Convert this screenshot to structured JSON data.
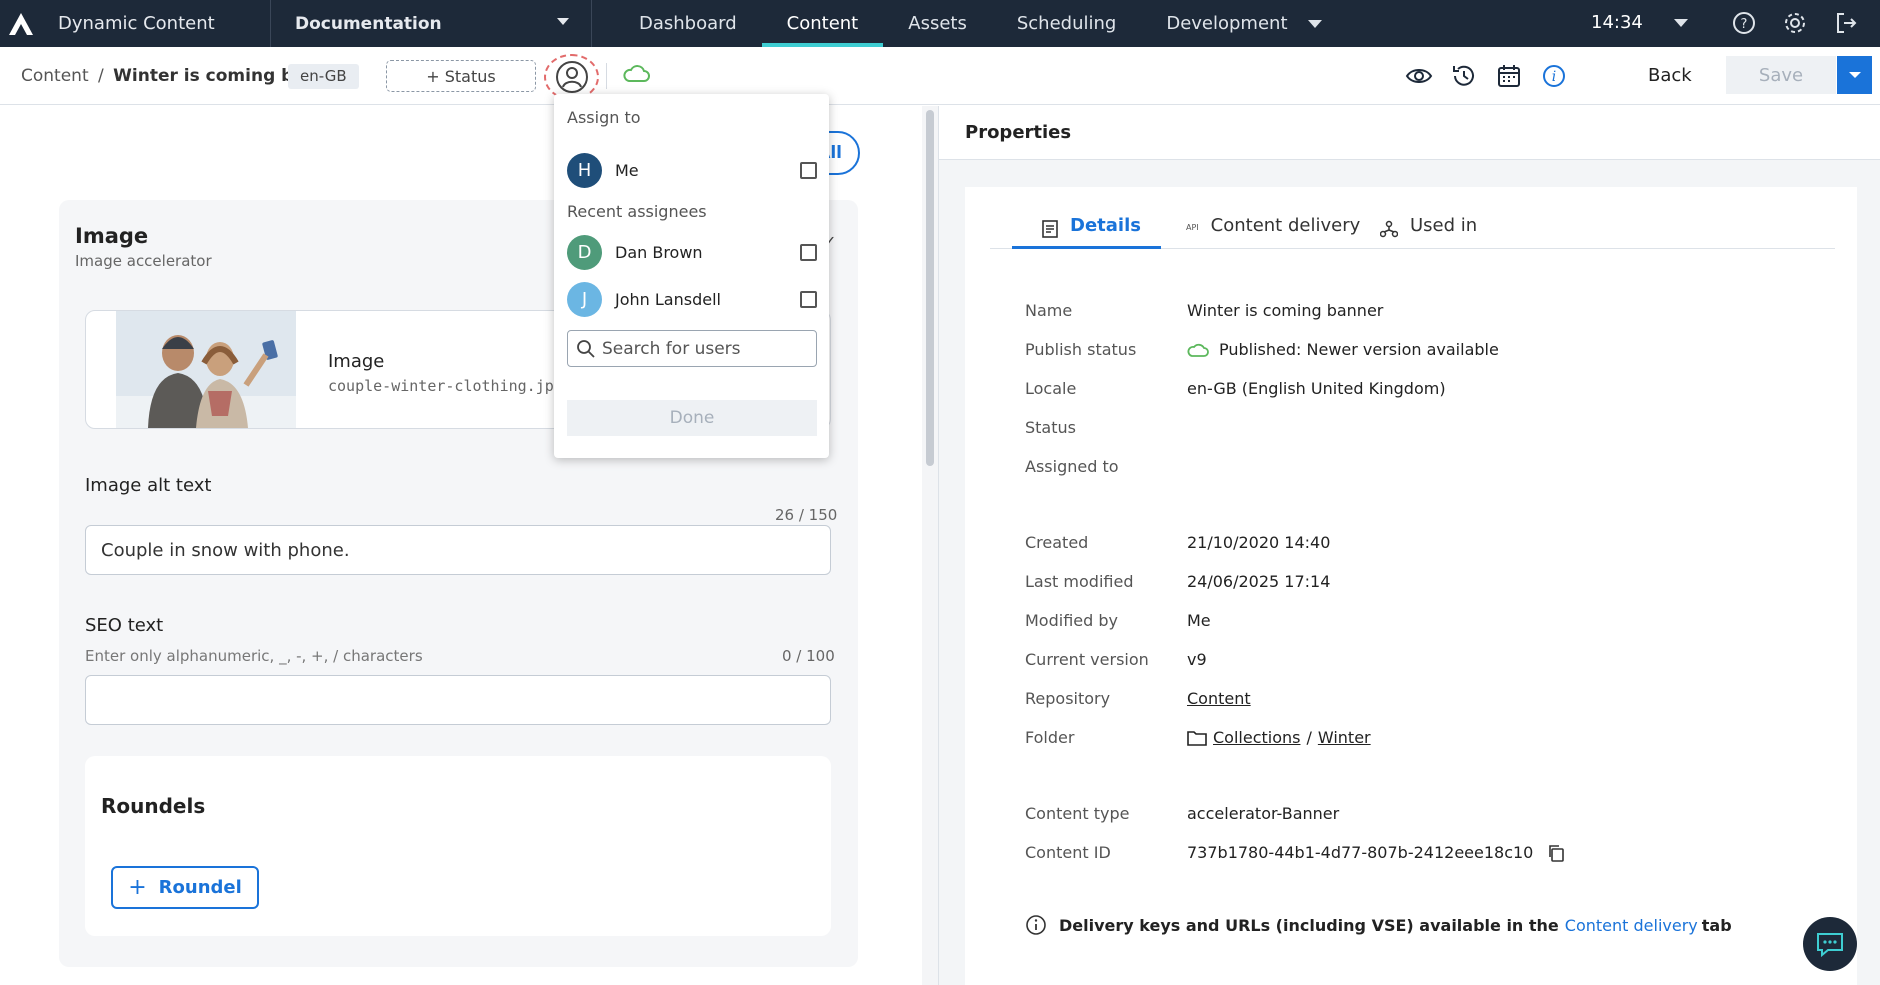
{
  "topnav": {
    "app_name": "Dynamic Content",
    "hub": "Documentation",
    "items": [
      "Dashboard",
      "Content",
      "Assets",
      "Scheduling",
      "Development"
    ],
    "active_item": "Content",
    "time": "14:34"
  },
  "toolbar": {
    "crumb_root": "Content",
    "crumb_sep": "/",
    "crumb_item": "Winter is coming banner",
    "locale": "en-GB",
    "status_label": "+ Status",
    "back_label": "Back",
    "save_label": "Save"
  },
  "editor": {
    "all_pill": "All",
    "card_title": "Image",
    "card_subtitle": "Image accelerator",
    "image_label": "Image",
    "image_file": "couple-winter-clothing.jpg",
    "alt_label": "Image alt text",
    "alt_counter": "26 / 150",
    "alt_value": "Couple in snow with phone.",
    "seo_label": "SEO text",
    "seo_hint": "Enter only alphanumeric, _, -, +, / characters",
    "seo_counter": "0 / 100",
    "seo_value": "",
    "roundels_title": "Roundels",
    "roundel_button": "Roundel"
  },
  "assign_dropdown": {
    "heading": "Assign to",
    "me": {
      "initial": "H",
      "name": "Me",
      "color": "#1f4e79"
    },
    "recent_heading": "Recent assignees",
    "recent": [
      {
        "initial": "D",
        "name": "Dan Brown",
        "color": "#4f9b7a"
      },
      {
        "initial": "J",
        "name": "John Lansdell",
        "color": "#6bb6e3"
      }
    ],
    "search_placeholder": "Search for users",
    "done_label": "Done"
  },
  "properties": {
    "title": "Properties",
    "tabs": [
      "Details",
      "Content delivery",
      "Used in"
    ],
    "tab_api_badge": "API",
    "active_tab": "Details",
    "rows": {
      "name_label": "Name",
      "name_value": "Winter is coming banner",
      "publish_label": "Publish status",
      "publish_value": "Published: Newer version available",
      "locale_label": "Locale",
      "locale_value": "en-GB (English United Kingdom)",
      "status_label": "Status",
      "assigned_label": "Assigned to",
      "created_label": "Created",
      "created_value": "21/10/2020 14:40",
      "modified_label": "Last modified",
      "modified_value": "24/06/2025 17:14",
      "modby_label": "Modified by",
      "modby_value": "Me",
      "version_label": "Current version",
      "version_value": "v9",
      "repo_label": "Repository",
      "repo_value": "Content",
      "folder_label": "Folder",
      "folder_value_1": "Collections",
      "folder_sep": "/",
      "folder_value_2": "Winter",
      "type_label": "Content type",
      "type_value": "accelerator-Banner",
      "id_label": "Content ID",
      "id_value": "737b1780-44b1-4d77-807b-2412eee18c10"
    },
    "note_text": "Delivery keys and URLs (including VSE) available in the",
    "note_link": "Content delivery",
    "note_tail": "tab"
  },
  "colors": {
    "accent": "#1a73d9",
    "nav_bg": "#1d2939",
    "nav_active": "#3ecdd2",
    "published_green": "#5cb85c"
  }
}
